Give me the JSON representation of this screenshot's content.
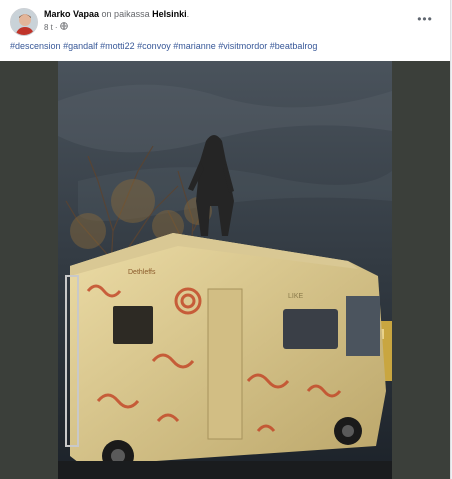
{
  "post": {
    "author": "Marko Vapaa",
    "location_prefix": "on paikassa",
    "location": "Helsinki",
    "location_suffix": ".",
    "timestamp": "8 t",
    "separator": "·",
    "audience_icon": "globe-icon",
    "more_icon": "more-horizontal-icon",
    "more_label": "•••",
    "hashtags": [
      "#descension",
      "#gandalf",
      "#motti22",
      "#convoy",
      "#marianne",
      "#visitmordor",
      "#beatbalrog"
    ]
  },
  "photo": {
    "van_brand": "Dethleffs",
    "sticker_text": "LIKE"
  },
  "colors": {
    "link": "#385898",
    "photo_background": "#3b3f3a",
    "night_sky": "#39424a"
  }
}
